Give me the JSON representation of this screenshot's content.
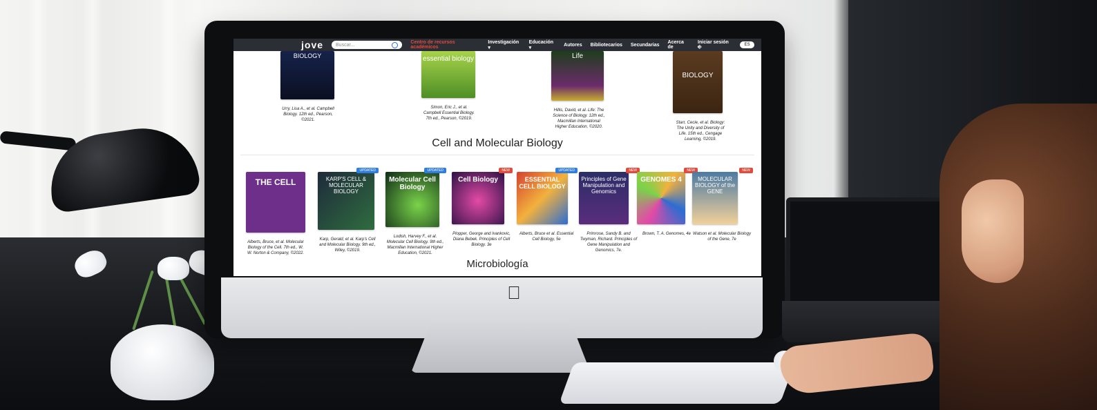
{
  "browser": {
    "logo": "jove",
    "search_placeholder": "Buscar...",
    "nav": [
      {
        "label": "Centro de recursos académicos",
        "style": "accent"
      },
      {
        "label": "Investigación ▾"
      },
      {
        "label": "Educación ▾"
      },
      {
        "label": "Autores"
      },
      {
        "label": "Bibliotecarios"
      },
      {
        "label": "Secundarias"
      },
      {
        "label": "Acerca de"
      },
      {
        "label": "Iniciar sesión ⎆"
      }
    ],
    "lang_toggle": "ES"
  },
  "top_books": [
    {
      "caption": "Urry, Lisa A., et al. Campbell Biology. 12th ed., Pearson, ©2021.",
      "cover_text": "BIOLOGY"
    },
    {
      "caption": "Simon, Eric J., et al. Campbell Essential Biology. 7th ed., Pearson, ©2019.",
      "cover_text": "essential biology"
    },
    {
      "caption": "Hillis, David, et al. Life: The Science of Biology. 12th ed., Macmillan International Higher Education, ©2020.",
      "cover_text": "Life"
    },
    {
      "caption": "Starr, Cecie, et al. Biology: The Unity and Diversity of Life. 15th ed., Cengage Learning, ©2019.",
      "cover_text": "BIOLOGY"
    }
  ],
  "sections": {
    "cell_molecular_title": "Cell and Molecular Biology",
    "micro_title": "Microbiología"
  },
  "cell_books": [
    {
      "cover_title": "THE CELL",
      "caption": "Alberts, Bruce, et al. Molecular Biology of the Cell. 7th ed., W. W. Norton & Company, ©2022.",
      "badge": ""
    },
    {
      "cover_title": "KARP'S CELL & MOLECULAR BIOLOGY",
      "caption": "Karp, Gerald, et al. Karp's Cell and Molecular Biology. 9th ed., Wiley, ©2019.",
      "badge": "UPDATED"
    },
    {
      "cover_title": "Molecular Cell Biology",
      "caption": "Lodish, Harvey F., et al. Molecular Cell Biology. 9th ed., Macmillan International Higher Education, ©2021.",
      "badge": "UPDATED"
    },
    {
      "cover_title": "Cell Biology",
      "caption": "Plopper, George and Ivankovic, Diana Bebek. Principles of Cell Biology. 3e",
      "badge": "NEW"
    },
    {
      "cover_title": "ESSENTIAL CELL BIOLOGY",
      "caption": "Alberts, Bruce et al. Essential Cell Biology, 5e",
      "badge": "UPDATED"
    },
    {
      "cover_title": "Principles of Gene Manipulation and Genomics",
      "caption": "Primrose, Sandy B. and Twyman, Richard. Principles of Gene Manipulation and Genomics, 7e.",
      "badge": "NEW"
    },
    {
      "cover_title": "GENOMES 4",
      "caption": "Brown, T. A. Genomes, 4e",
      "badge": "NEW"
    },
    {
      "cover_title": "MOLECULAR BIOLOGY of the GENE",
      "caption": "Watson et al. Molecular Biology of the Gene, 7e",
      "badge": "NEW"
    }
  ],
  "colors": {
    "nav_bg": "#2b2f35",
    "accent_red": "#e24a3b",
    "badge_blue": "#2f7de1"
  }
}
